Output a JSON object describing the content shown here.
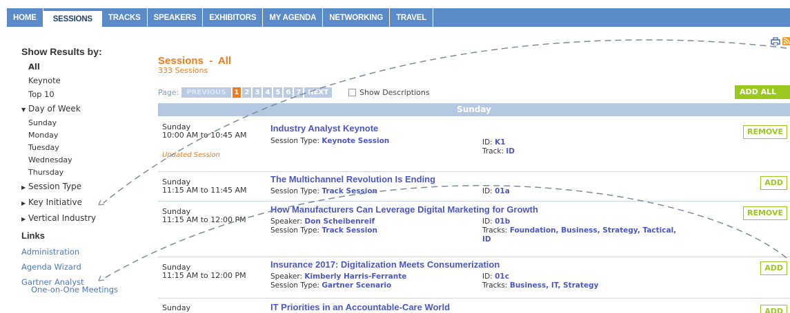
{
  "nav": {
    "tabs": [
      "HOME",
      "SESSIONS",
      "TRACKS",
      "SPEAKERS",
      "EXHIBITORS",
      "MY AGENDA",
      "NETWORKING",
      "TRAVEL"
    ]
  },
  "sidebar": {
    "heading": "Show Results by:",
    "items": [
      "All",
      "Keynote",
      "Top 10"
    ],
    "day_toggle": "Day of Week",
    "days": [
      "Sunday",
      "Monday",
      "Tuesday",
      "Wednesday",
      "Thursday"
    ],
    "toggles": [
      "Session Type",
      "Key Initiative",
      "Vertical Industry"
    ],
    "links_heading": "Links",
    "links": [
      "Administration",
      "Agenda Wizard",
      "Gartner Analyst"
    ],
    "links_sub": "One-on-One Meetings"
  },
  "main": {
    "title": "Sessions  -  All",
    "count": "333 Sessions",
    "page_label": "Page:",
    "prev": "PREVIOUS",
    "pages": [
      "1",
      "2",
      "3",
      "4",
      "5",
      "6",
      "7"
    ],
    "next": "NEXT",
    "show_descriptions": "Show Descriptions",
    "add_all": "ADD ALL",
    "day_band": "Sunday"
  },
  "sessions": [
    {
      "day": "Sunday",
      "time": "10:00 AM to 10:45 AM",
      "title": "Industry Analyst Keynote",
      "speaker_label": "",
      "speaker": "",
      "type_label": "Session Type:",
      "type": "Keynote Session",
      "id_label": "ID:",
      "id": "K1",
      "track_label": "Track:",
      "track": "ID",
      "note": "Updated Session",
      "action": "REMOVE"
    },
    {
      "day": "Sunday",
      "time": "11:15 AM to 11:45 AM",
      "title": "The Multichannel Revolution Is Ending",
      "type_label": "Session Type:",
      "type": "Track Session",
      "id_label": "ID:",
      "id": "01a",
      "action": "ADD"
    },
    {
      "day": "Sunday",
      "time": "11:15 AM to 12:00 PM",
      "title": "How Manufacturers Can Leverage Digital Marketing for Growth",
      "speaker_label": "Speaker:",
      "speaker": "Don Scheibenreif",
      "type_label": "Session Type:",
      "type": "Track Session",
      "id_label": "ID:",
      "id": "01b",
      "track_label": "Tracks:",
      "track": "Foundation, Business, Strategy, Tactical, ID",
      "action": "REMOVE"
    },
    {
      "day": "Sunday",
      "time": "11:15 AM to 12:00 PM",
      "title": "Insurance 2017: Digitalization Meets Consumerization",
      "speaker_label": "Speaker:",
      "speaker": "Kimberly Harris-Ferrante",
      "type_label": "Session Type:",
      "type": "Gartner Scenario",
      "id_label": "ID:",
      "id": "01c",
      "track_label": "Tracks:",
      "track": "Business, IT, Strategy",
      "action": "ADD"
    },
    {
      "day": "Sunday",
      "title": "IT Priorities in an Accountable-Care World",
      "action": "ADD"
    }
  ],
  "colors": {
    "nav_bg": "#5b8ac8",
    "accent_orange": "#f07a1c",
    "link_blue": "#4a56c6",
    "add_green": "#9ac81e",
    "day_band": "#b5c8e1"
  },
  "icons": [
    "print-icon",
    "rss-icon"
  ]
}
